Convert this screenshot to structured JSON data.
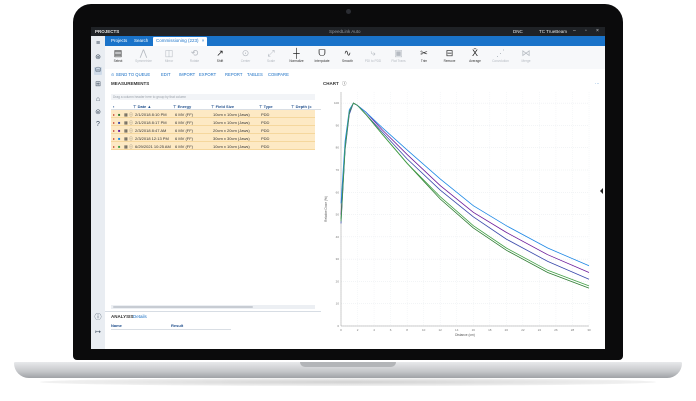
{
  "window": {
    "projects_label": "PROJECTS",
    "app_title": "SpeedLink Auto",
    "org": "DNC",
    "user": "TC TrueBeam",
    "controls": [
      "–",
      "▫",
      "×"
    ]
  },
  "tabs": [
    {
      "label": "Projects",
      "active": false
    },
    {
      "label": "Search",
      "active": false
    },
    {
      "label": "Commissioning (223)",
      "active": true
    }
  ],
  "toolbar": {
    "tools": [
      {
        "label": "Select",
        "icon": "select-icon",
        "glyph": "▤",
        "enabled": true
      },
      {
        "label": "Symmetrize",
        "icon": "symmetrize-icon",
        "glyph": "⋀",
        "enabled": false
      },
      {
        "label": "Mirror",
        "icon": "mirror-icon",
        "glyph": "◫",
        "enabled": false
      },
      {
        "label": "Rotate",
        "icon": "rotate-icon",
        "glyph": "⟲",
        "enabled": false
      },
      {
        "label": "Shift",
        "icon": "shift-icon",
        "glyph": "↗",
        "enabled": true
      },
      {
        "label": "Center",
        "icon": "center-icon",
        "glyph": "⊙",
        "enabled": false
      },
      {
        "label": "Scale",
        "icon": "scale-icon",
        "glyph": "⤢",
        "enabled": false
      },
      {
        "label": "Normalize",
        "icon": "normalize-icon",
        "glyph": "┼",
        "enabled": true
      },
      {
        "label": "Interpolate",
        "icon": "interpolate-icon",
        "glyph": "ᗜ",
        "enabled": true
      },
      {
        "label": "Smooth",
        "icon": "smooth-icon",
        "glyph": "∿",
        "enabled": true
      },
      {
        "label": "PDI to PDD",
        "icon": "pdi-to-pdd-icon",
        "glyph": "⤷",
        "enabled": false
      },
      {
        "label": "Flat Trans",
        "icon": "flat-trans-icon",
        "glyph": "▣",
        "enabled": false
      },
      {
        "label": "Trim",
        "icon": "trim-icon",
        "glyph": "✂",
        "enabled": true
      },
      {
        "label": "Remove",
        "icon": "remove-icon",
        "glyph": "⊟",
        "enabled": true
      },
      {
        "label": "Average",
        "icon": "average-icon",
        "glyph": "X̄",
        "enabled": true
      },
      {
        "label": "Convolution",
        "icon": "convolution-icon",
        "glyph": "⋰",
        "enabled": false
      },
      {
        "label": "Merge",
        "icon": "merge-icon",
        "glyph": "⋈",
        "enabled": false
      }
    ]
  },
  "actions": [
    "SEND TO QUEUE",
    "EDIT",
    "IMPORT",
    "EXPORT",
    "REPORT",
    "TABLES",
    "COMPARE"
  ],
  "measurements": {
    "title": "MEASUREMENTS",
    "group_hint": "Drag a column header here to group by that column",
    "columns": [
      "Date",
      "Energy",
      "Field Size",
      "Type",
      "Depth (c"
    ],
    "rows": [
      {
        "date": "2/1/2018 8:10 PM",
        "energy": "6 MV (FF)",
        "field": "10cm x 10cm (Jaws)",
        "type": "PDD",
        "color": "#2e7d32"
      },
      {
        "date": "2/1/2018 8:17 PM",
        "energy": "6 MV (FF)",
        "field": "10cm x 10cm (Jaws)",
        "type": "PDD",
        "color": "#3949ab"
      },
      {
        "date": "2/3/2018 8:47 AM",
        "energy": "6 MV (FF)",
        "field": "20cm x 20cm (Jaws)",
        "type": "PDD",
        "color": "#6a1b9a"
      },
      {
        "date": "2/3/2018 12:13 PM",
        "energy": "6 MV (FF)",
        "field": "30cm x 30cm (Jaws)",
        "type": "PDD",
        "color": "#1e88e5"
      },
      {
        "date": "6/29/2021 10:25 AM",
        "energy": "6 MV (FF)",
        "field": "10cm x 10cm (Jaws)",
        "type": "PDD",
        "color": "#43a047"
      }
    ]
  },
  "analysis": {
    "title": "ANALYSIS",
    "link": "Details",
    "columns": [
      "Name",
      "Result"
    ]
  },
  "chart_data": {
    "type": "line",
    "title": "CHART",
    "xlabel": "Distance (cm)",
    "ylabel": "Relative Dose (%)",
    "xlim": [
      0,
      30
    ],
    "ylim": [
      0,
      105
    ],
    "series": [
      {
        "color": "#2e7d32",
        "x": [
          0,
          0.5,
          1,
          1.5,
          2,
          3,
          5,
          8,
          12,
          16,
          20,
          25,
          30
        ],
        "y": [
          48,
          80,
          96,
          100,
          99,
          95,
          86,
          73,
          57,
          44,
          34,
          24,
          17
        ]
      },
      {
        "color": "#3949ab",
        "x": [
          0,
          0.5,
          1,
          1.5,
          2,
          3,
          5,
          8,
          12,
          16,
          20,
          25,
          30
        ],
        "y": [
          46,
          79,
          95,
          100,
          99,
          95,
          87,
          75,
          61,
          49,
          39,
          29,
          21
        ]
      },
      {
        "color": "#6a1b9a",
        "x": [
          0,
          0.5,
          1,
          1.5,
          2,
          3,
          5,
          8,
          12,
          16,
          20,
          25,
          30
        ],
        "y": [
          50,
          81,
          96,
          100,
          99,
          96,
          88,
          77,
          63,
          51,
          42,
          32,
          24
        ]
      },
      {
        "color": "#1e88e5",
        "x": [
          0,
          0.5,
          1,
          1.5,
          2,
          3,
          5,
          8,
          12,
          16,
          20,
          25,
          30
        ],
        "y": [
          55,
          83,
          97,
          100,
          99,
          96,
          89,
          79,
          66,
          54,
          45,
          35,
          27
        ]
      },
      {
        "color": "#43a047",
        "x": [
          0,
          0.5,
          1,
          1.5,
          2,
          3,
          5,
          8,
          12,
          16,
          20,
          25,
          30
        ],
        "y": [
          47,
          80,
          96,
          100,
          99,
          95,
          86,
          73,
          58,
          45,
          35,
          25,
          18
        ]
      }
    ]
  }
}
